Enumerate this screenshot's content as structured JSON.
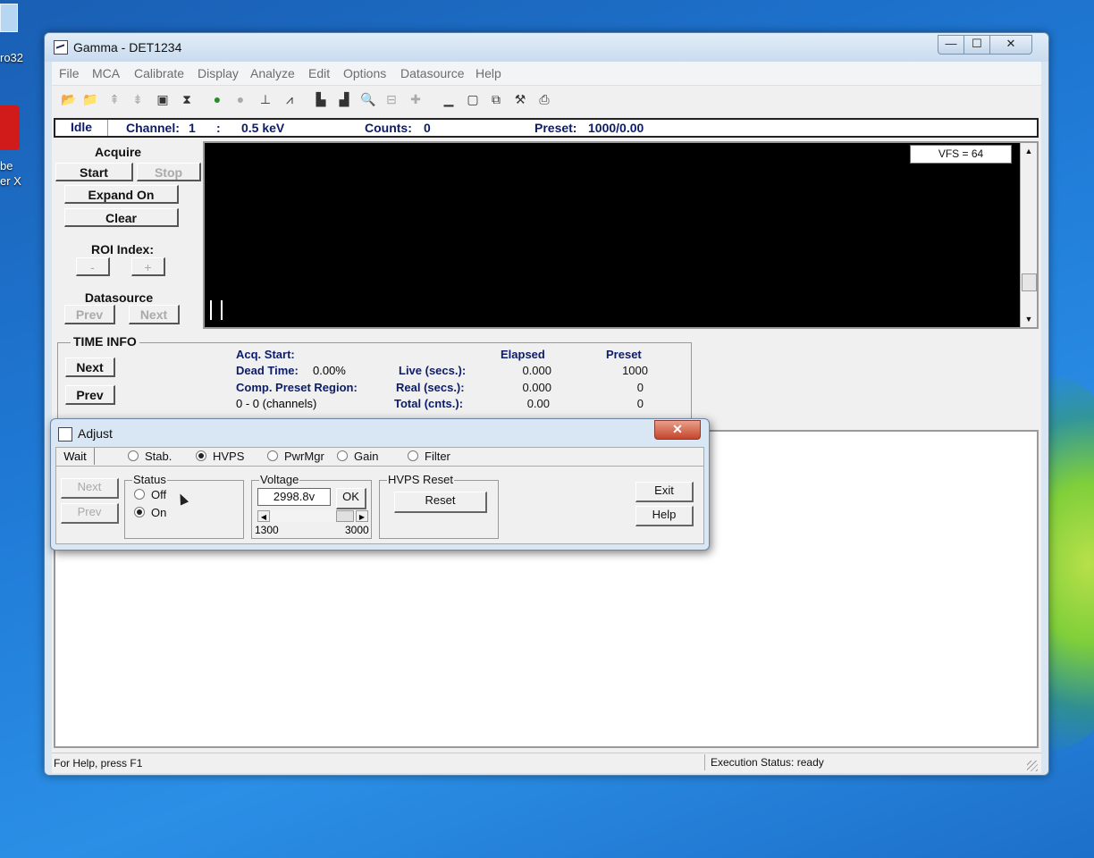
{
  "desktop": {
    "icon1_label": "ro32",
    "icon2_label_line1": "be",
    "icon2_label_line2": "er X"
  },
  "window": {
    "title": "Gamma - DET1234",
    "controls": {
      "minimize": "—",
      "maximize": "☐",
      "close": "✕"
    }
  },
  "menu": [
    "File",
    "MCA",
    "Calibrate",
    "Display",
    "Analyze",
    "Edit",
    "Options",
    "Datasource",
    "Help"
  ],
  "toolbar_icons": [
    "open-folder-icon",
    "open-file-icon",
    "upload-icon",
    "download-icon",
    "save-icon",
    "hourglass-icon",
    "start-icon",
    "stop-icon",
    "baseline-icon",
    "peak-icon",
    "bar-chart-icon",
    "bar-chart-alt-icon",
    "zoom-icon",
    "zoom-out-icon",
    "add-icon",
    "minimize-view-icon",
    "window-icon",
    "cascade-icon",
    "tool-icon",
    "print-icon"
  ],
  "infobar": {
    "state": "Idle",
    "channel_label": "Channel:",
    "channel_value": "1",
    "sep": ":",
    "energy": "0.5 keV",
    "counts_label": "Counts:",
    "counts_value": "0",
    "preset_label": "Preset:",
    "preset_value": "1000/0.00"
  },
  "left_panel": {
    "acquire": "Acquire",
    "start": "Start",
    "stop": "Stop",
    "expand": "Expand On",
    "clear": "Clear",
    "roi_index": "ROI Index:",
    "roi_minus": "-",
    "roi_plus": "+",
    "datasource": "Datasource",
    "ds_prev": "Prev",
    "ds_next": "Next"
  },
  "spectrum": {
    "vfs": "VFS = 64"
  },
  "time_info": {
    "title": "TIME INFO",
    "next": "Next",
    "prev": "Prev",
    "acq_start": "Acq. Start:",
    "dead_time_label": "Dead Time:",
    "dead_time_value": "0.00%",
    "comp_preset": "Comp. Preset Region:",
    "channels": "0 - 0 (channels)",
    "col_elapsed": "Elapsed",
    "col_preset": "Preset",
    "rows": [
      {
        "label": "Live (secs.):",
        "elapsed": "0.000",
        "preset": "1000"
      },
      {
        "label": "Real (secs.):",
        "elapsed": "0.000",
        "preset": "0"
      },
      {
        "label": "Total (cnts.):",
        "elapsed": "0.00",
        "preset": "0"
      }
    ]
  },
  "statusbar": {
    "left": "For Help, press F1",
    "right": "Execution Status: ready"
  },
  "adjust": {
    "title": "Adjust",
    "close": "✕",
    "wait": "Wait",
    "radios": [
      {
        "label": "Stab.",
        "checked": false
      },
      {
        "label": "HVPS",
        "checked": true
      },
      {
        "label": "PwrMgr",
        "checked": false
      },
      {
        "label": "Gain",
        "checked": false
      },
      {
        "label": "Filter",
        "checked": false
      }
    ],
    "next": "Next",
    "prev": "Prev",
    "status_group": "Status",
    "status_off": "Off",
    "status_on": "On",
    "voltage_group": "Voltage",
    "voltage_value": "2998.8v",
    "ok": "OK",
    "voltage_min": "1300",
    "voltage_max": "3000",
    "hvps_reset_group": "HVPS Reset",
    "reset": "Reset",
    "exit": "Exit",
    "help": "Help"
  }
}
